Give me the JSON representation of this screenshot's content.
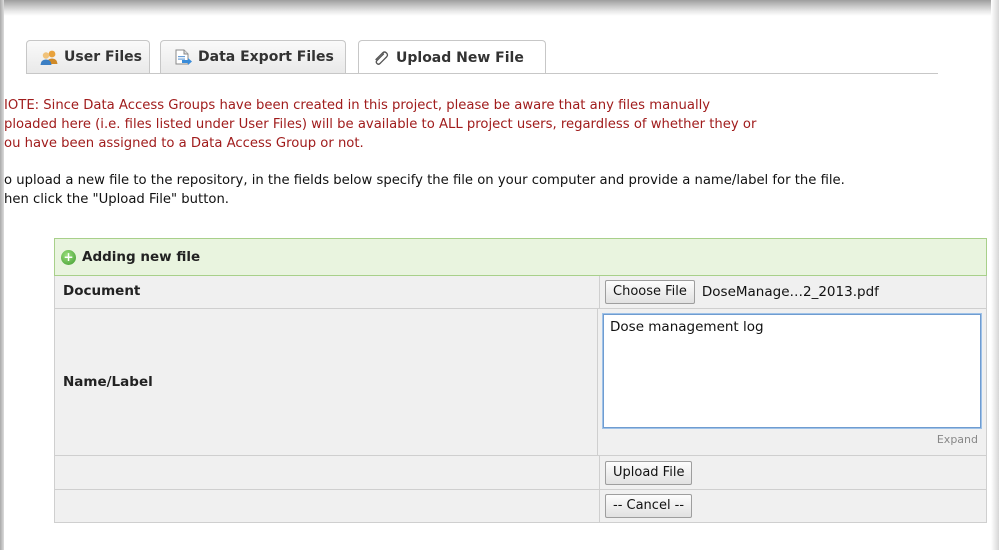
{
  "tabs": [
    {
      "label": "User Files",
      "icon": "users-icon",
      "active": false
    },
    {
      "label": "Data Export Files",
      "icon": "export-file-icon",
      "active": false
    },
    {
      "label": "Upload New File",
      "icon": "paperclip-icon",
      "active": true
    }
  ],
  "note": {
    "line1": "IOTE: Since Data Access Groups have been created in this project, please be aware that any files manually",
    "line2": "ploaded here (i.e. files listed under User Files) will be available to ALL project users, regardless of whether they or",
    "line3": "ou have been assigned to a Data Access Group or not."
  },
  "instructions": {
    "line1": "o upload a new file to the repository, in the fields below specify the file on your computer and provide a name/label for the file.",
    "line2": "hen click the \"Upload File\" button."
  },
  "form": {
    "header": "Adding new file",
    "document_label": "Document",
    "choose_file_label": "Choose File",
    "file_name": "DoseManage…2_2013.pdf",
    "name_label": "Name/Label",
    "name_value": "Dose management log",
    "expand_label": "Expand",
    "upload_label": "Upload File",
    "cancel_label": "-- Cancel --"
  },
  "colors": {
    "note_text": "#a01c1c",
    "form_header_bg": "#e9f4df",
    "form_header_border": "#a8d08a"
  }
}
